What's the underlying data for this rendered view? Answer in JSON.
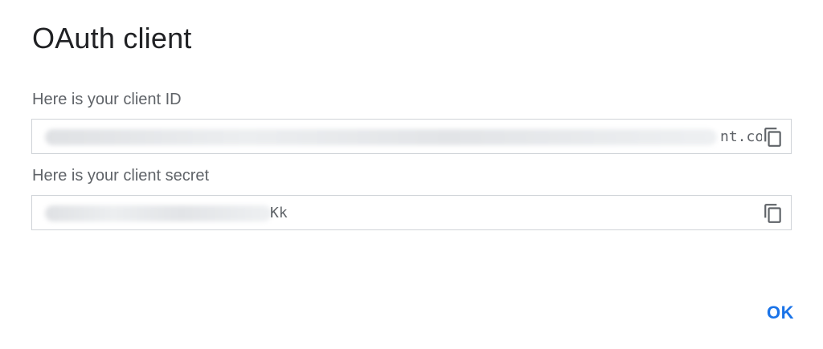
{
  "dialog": {
    "title": "OAuth client",
    "client_id": {
      "label": "Here is your client ID",
      "visible_tail": "nt.co",
      "copy_icon": "copy-icon"
    },
    "client_secret": {
      "label": "Here is your client secret",
      "visible_tail": "Kk",
      "copy_icon": "copy-icon"
    },
    "ok_label": "OK"
  },
  "colors": {
    "primary": "#1a73e8",
    "label": "#5f6368",
    "border": "#cfd3d7",
    "title": "#202124"
  }
}
